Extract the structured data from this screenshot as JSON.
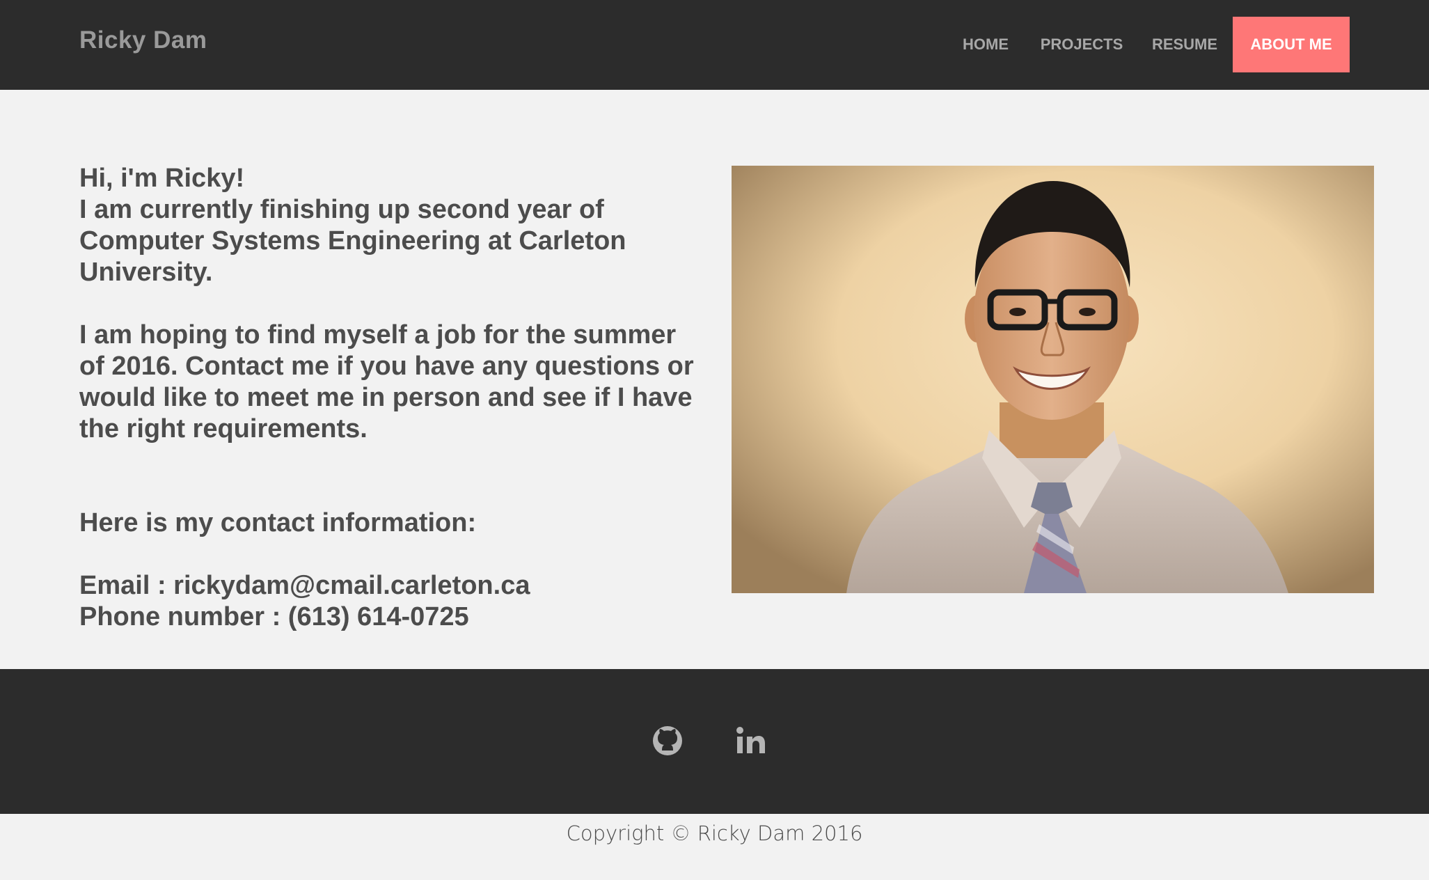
{
  "nav": {
    "brand": "Ricky Dam",
    "items": [
      {
        "label": "HOME"
      },
      {
        "label": "PROJECTS"
      },
      {
        "label": "RESUME"
      },
      {
        "label": "ABOUT ME",
        "active": true
      }
    ],
    "active_color": "#fe7777"
  },
  "intro": {
    "greeting": "Hi, i'm Ricky!",
    "line1": "I am currently finishing up second year of Computer Systems Engineering at Carleton University.",
    "paragraph2": "I am hoping to find myself a job for the summer of 2016. Contact me if you have any questions or would like to meet me in person and see if I have the right requirements.",
    "contact_heading": "Here is my contact information:",
    "email": "Email : rickydam@cmail.carleton.ca",
    "phone": "Phone number : (613) 614-0725"
  },
  "footer": {
    "icons": [
      "github-icon",
      "linkedin-icon"
    ],
    "copyright": "Copyright © Ricky Dam 2016"
  },
  "colors": {
    "nav_bg": "#2c2c2c",
    "page_bg": "#f2f2f2",
    "accent": "#fe7777"
  }
}
